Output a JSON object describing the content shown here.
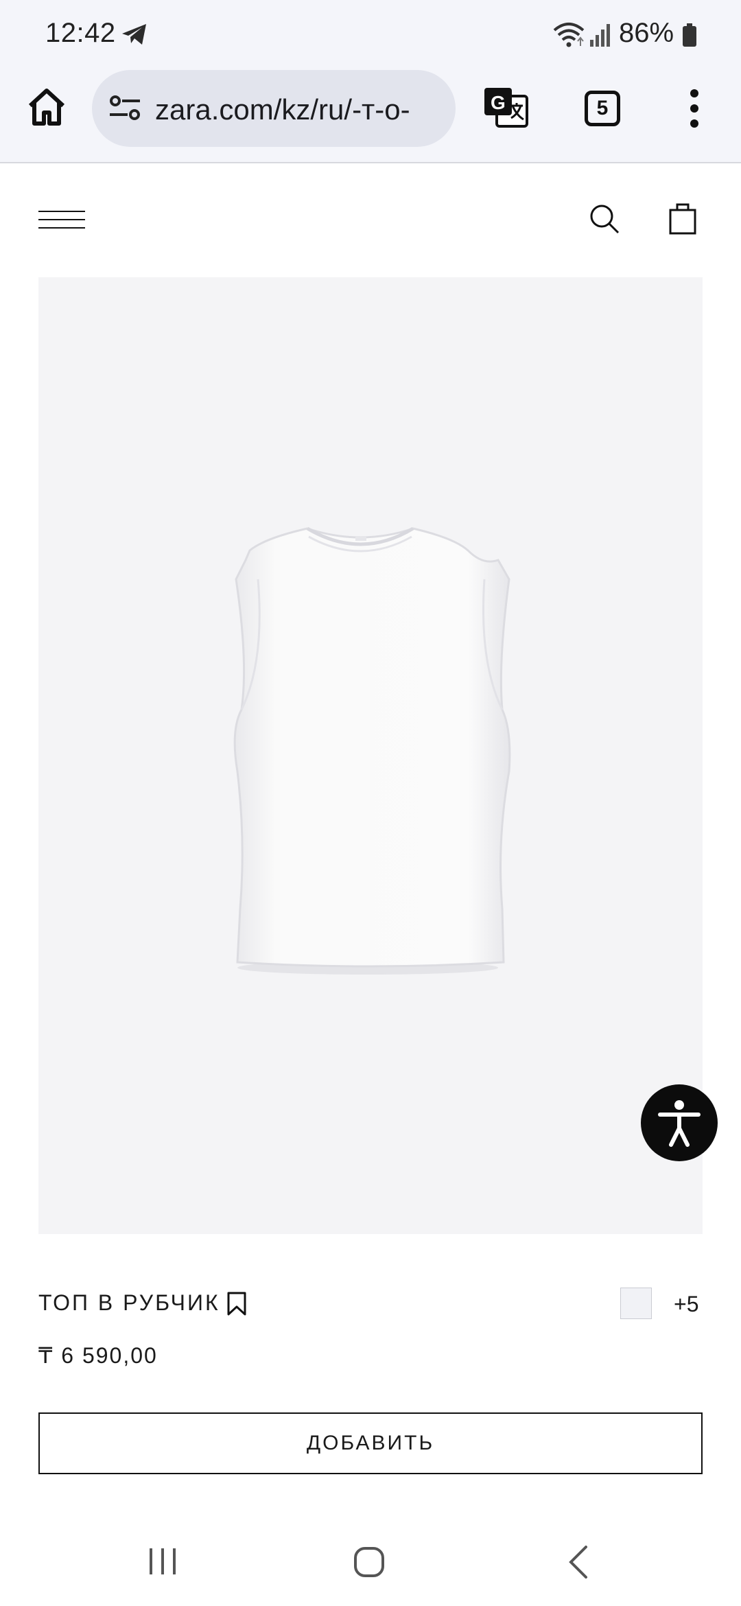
{
  "status_bar": {
    "time": "12:42",
    "battery_percent": "86%",
    "icons": [
      "telegram-icon",
      "wifi-icon",
      "signal-icon",
      "battery-icon"
    ]
  },
  "browser": {
    "url": "zara.com/kz/ru/-т-о-",
    "tab_count": "5",
    "icons": [
      "home-icon",
      "site-settings-icon",
      "translate-icon",
      "tab-switcher-icon",
      "overflow-menu-icon"
    ]
  },
  "site_header": {
    "icons": [
      "menu-icon",
      "search-icon",
      "shopping-bag-icon"
    ]
  },
  "product": {
    "name": "ТОП В РУБЧИК",
    "price": "₸ 6 590,00",
    "more_colors": "+5",
    "swatch_color": "#f1f2f6",
    "add_button_label": "ДОБАВИТЬ"
  },
  "floating": {
    "accessibility_icon": "accessibility-icon"
  },
  "system_nav": {
    "icons": [
      "recent-apps-icon",
      "home-button-icon",
      "back-icon"
    ]
  }
}
